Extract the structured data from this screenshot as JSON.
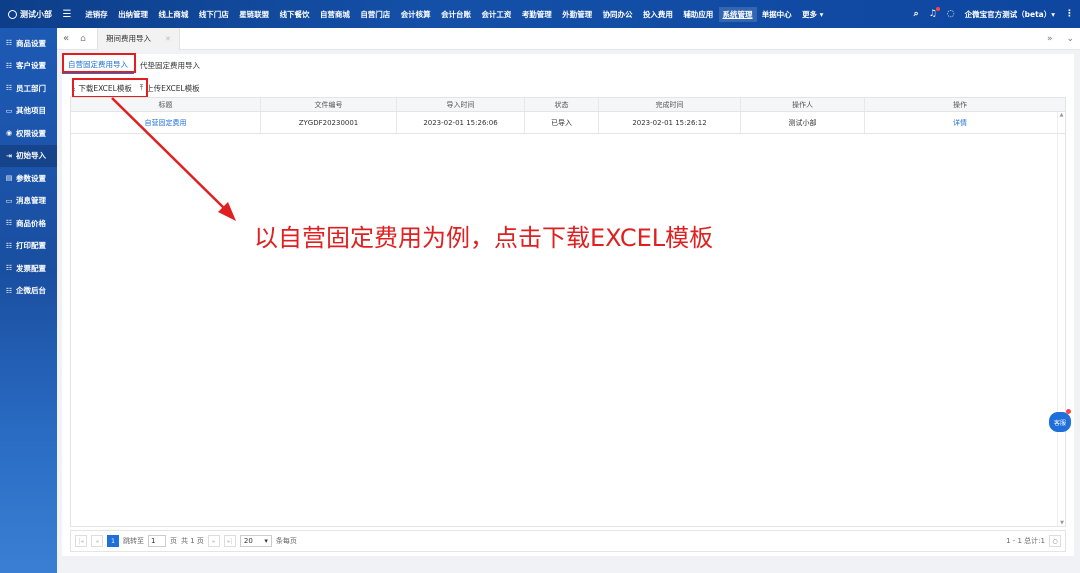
{
  "topbar": {
    "brand": "测试小部",
    "nav": [
      "进销存",
      "出纳管理",
      "线上商城",
      "线下门店",
      "星链联盟",
      "线下餐饮",
      "自营商城",
      "自营门店",
      "会计核算",
      "会计台账",
      "会计工资",
      "考勤管理",
      "外勤管理",
      "协同办公",
      "投入费用",
      "辅助应用",
      "系统管理",
      "单据中心",
      "更多 ▾"
    ],
    "active_index": 16,
    "company": "企微宝官方测试（beta）▾"
  },
  "sidebar": {
    "items": [
      {
        "icon": "☷",
        "label": "商品设置"
      },
      {
        "icon": "☷",
        "label": "客户设置"
      },
      {
        "icon": "☷",
        "label": "员工部门"
      },
      {
        "icon": "▭",
        "label": "其他项目"
      },
      {
        "icon": "◉",
        "label": "权限设置"
      },
      {
        "icon": "⇥",
        "label": "初始导入"
      },
      {
        "icon": "▤",
        "label": "参数设置"
      },
      {
        "icon": "▭",
        "label": "消息管理"
      },
      {
        "icon": "☷",
        "label": "商品价格"
      },
      {
        "icon": "☷",
        "label": "打印配置"
      },
      {
        "icon": "☷",
        "label": "发票配置"
      },
      {
        "icon": "☷",
        "label": "企微后台"
      }
    ],
    "active_index": 5
  },
  "tabs": {
    "current": "期间费用导入"
  },
  "subtabs": [
    "自营固定费用导入",
    "代垫固定费用导入"
  ],
  "toolbar": {
    "download": "下载EXCEL模板",
    "upload": "上传EXCEL模板"
  },
  "table": {
    "headers": [
      "标题",
      "文件编号",
      "导入时间",
      "状态",
      "完成时间",
      "操作人",
      "操作"
    ],
    "rows": [
      [
        "自营固定费用",
        "ZYGDF20230001",
        "2023-02-01 15:26:06",
        "已导入",
        "2023-02-01 15:26:12",
        "测试小部",
        "详情"
      ]
    ]
  },
  "pager": {
    "current_page": "1",
    "jump_label": "跳转至",
    "jump_value": "1",
    "page_suffix": "页",
    "total_pages": "共 1 页",
    "page_size": "20",
    "per_page_label": "条每页",
    "range": "1 - 1 总计:1"
  },
  "annotation": "以自营固定费用为例，点击下载EXCEL模板",
  "kefu": "客服",
  "colors": {
    "accent": "#1e6fd9",
    "annotation": "#e02020",
    "topbar": "#1450a8"
  }
}
